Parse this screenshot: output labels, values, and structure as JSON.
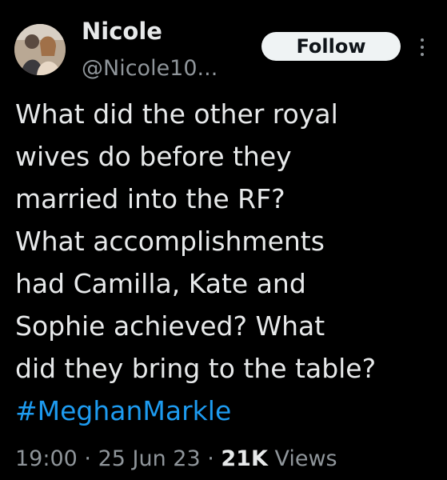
{
  "user": {
    "display_name": "Nicole",
    "handle": "@Nicole10..."
  },
  "follow_button": {
    "label": "Follow"
  },
  "more_icon": "more-vertical-icon",
  "tweet": {
    "lines": [
      "What did the other royal",
      "wives do before they",
      "married into the RF?",
      "What accomplishments",
      "had Camilla, Kate and",
      "Sophie achieved? What",
      "did they bring to the table?"
    ],
    "hashtag": "#MeghanMarkle"
  },
  "meta": {
    "time": "19:00",
    "separator": " · ",
    "date": "25 Jun 23",
    "views_count": "21K",
    "views_label": " Views"
  },
  "colors": {
    "background": "#000000",
    "text": "#e7e9ea",
    "secondary": "#8f959a",
    "link": "#1d9bf0",
    "button_bg": "#eff3f4"
  }
}
